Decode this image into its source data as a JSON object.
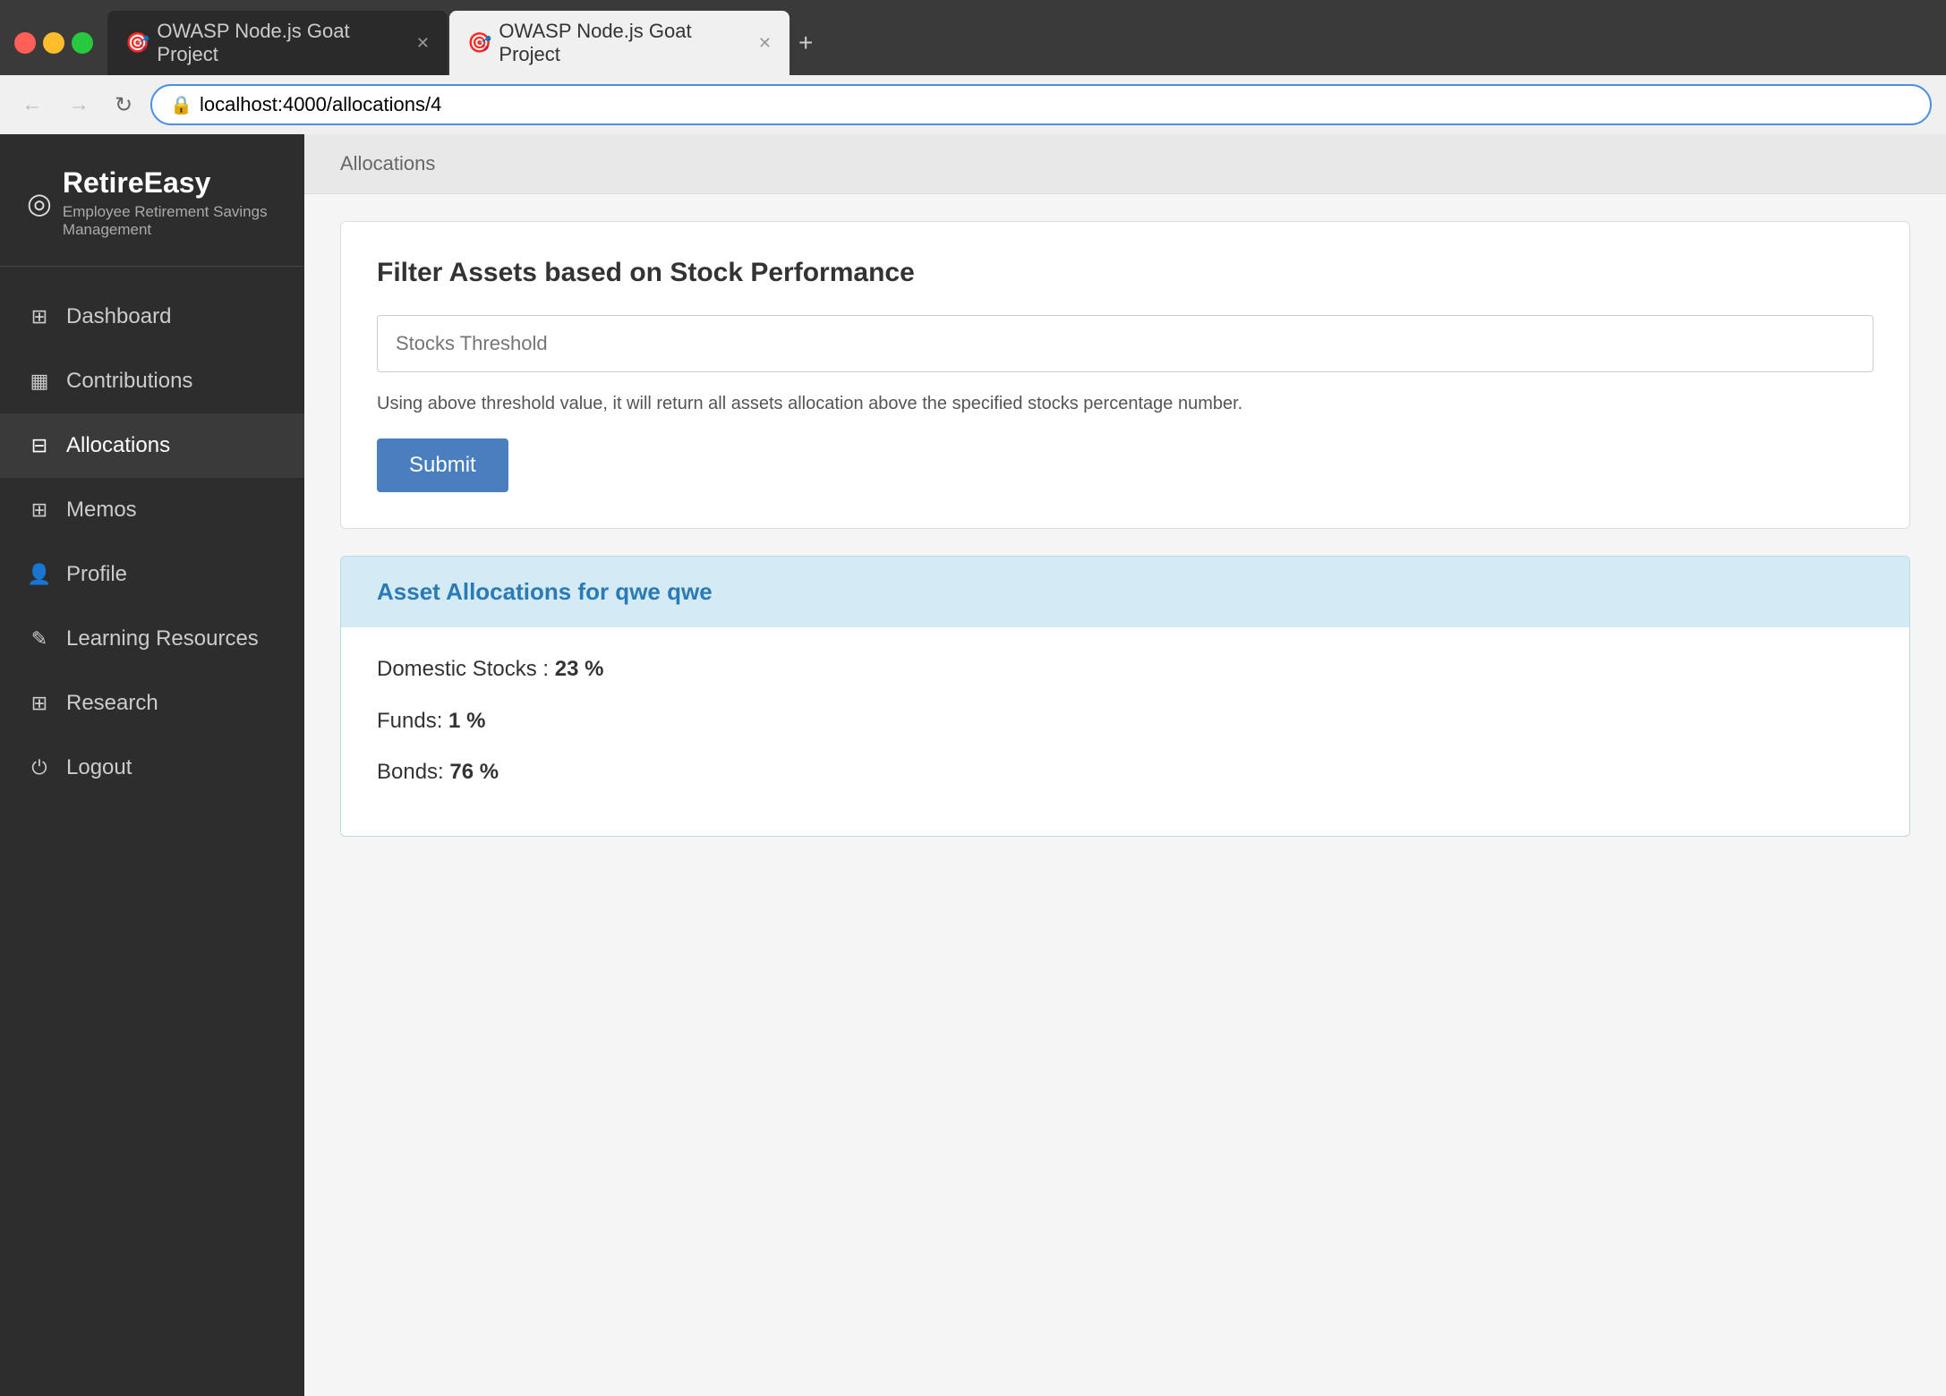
{
  "browser": {
    "tabs": [
      {
        "id": "tab1",
        "title": "OWASP Node.js Goat Project",
        "active": false,
        "favicon": "🎯"
      },
      {
        "id": "tab2",
        "title": "OWASP Node.js Goat Project",
        "active": true,
        "favicon": "🎯"
      }
    ],
    "new_tab_label": "+",
    "address": {
      "protocol": "localhost:4000",
      "path": "/allocations/4",
      "full": "localhost:4000/allocations/4"
    },
    "nav": {
      "back": "←",
      "forward": "→",
      "refresh": "↻"
    }
  },
  "brand": {
    "logo": "◎",
    "name_part1": "Retire",
    "name_part2": "Easy",
    "tagline": "Employee Retirement Savings Management"
  },
  "sidebar": {
    "items": [
      {
        "id": "dashboard",
        "label": "Dashboard",
        "icon": "▦",
        "active": false
      },
      {
        "id": "contributions",
        "label": "Contributions",
        "icon": "▥",
        "active": false
      },
      {
        "id": "allocations",
        "label": "Allocations",
        "icon": "▤",
        "active": true
      },
      {
        "id": "memos",
        "label": "Memos",
        "icon": "▤",
        "active": false
      },
      {
        "id": "profile",
        "label": "Profile",
        "icon": "👤",
        "active": false
      },
      {
        "id": "learning-resources",
        "label": "Learning Resources",
        "icon": "✎",
        "active": false
      },
      {
        "id": "research",
        "label": "Research",
        "icon": "▦",
        "active": false
      },
      {
        "id": "logout",
        "label": "Logout",
        "icon": "⏻",
        "active": false
      }
    ]
  },
  "page": {
    "breadcrumb": "Allocations",
    "filter_section": {
      "title": "Filter Assets based on Stock Performance",
      "input_placeholder": "Stocks Threshold",
      "helper_text": "Using above threshold value, it will return all assets allocation above the specified stocks percentage number.",
      "submit_label": "Submit"
    },
    "results_section": {
      "title": "Asset Allocations for qwe qwe",
      "allocations": [
        {
          "label": "Domestic Stocks :",
          "value": "23 %"
        },
        {
          "label": "Funds:",
          "value": "1 %"
        },
        {
          "label": "Bonds:",
          "value": "76 %"
        }
      ]
    }
  }
}
